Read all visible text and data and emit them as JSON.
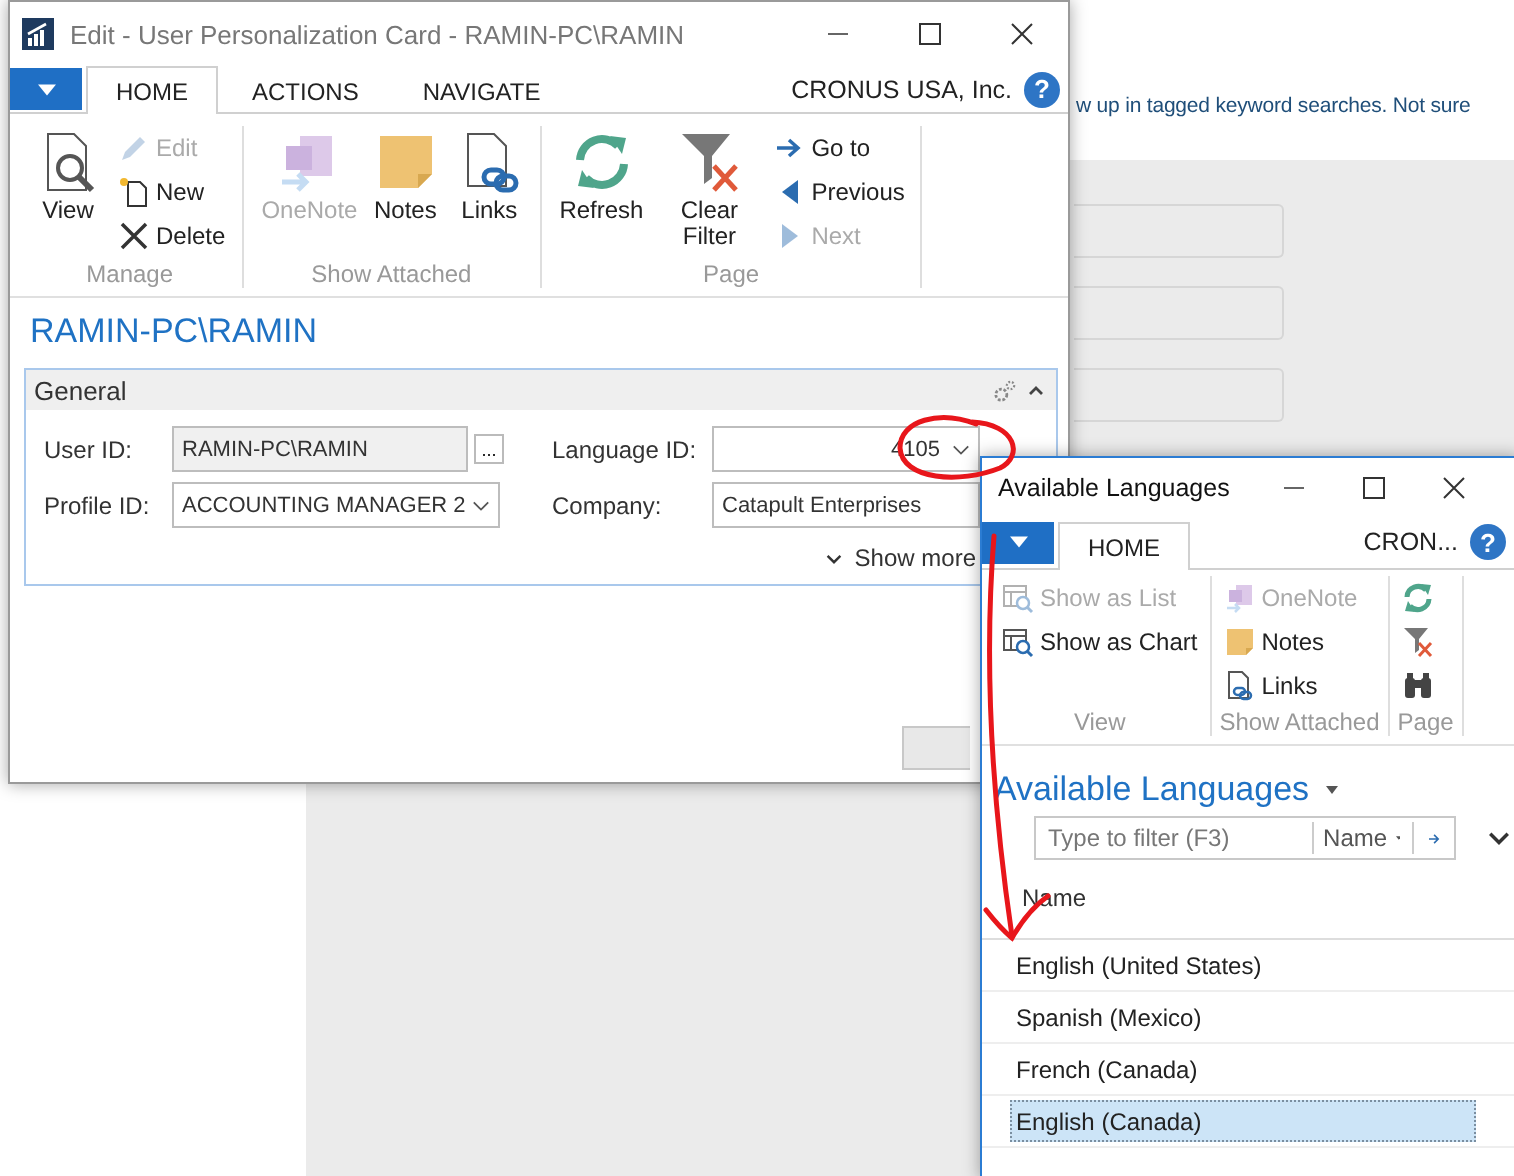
{
  "page": {
    "text": "w up in tagged keyword searches. Not sure"
  },
  "windows": [
    {
      "kind": "card",
      "title": "Edit - User Personalization Card - RAMIN-PC\\RAMIN",
      "tabs": [
        {
          "label": "HOME",
          "selected": true
        },
        {
          "label": "ACTIONS",
          "selected": false
        },
        {
          "label": "NAVIGATE",
          "selected": false
        }
      ],
      "company": "CRONUS USA, Inc.",
      "help": "?",
      "ribbon": [
        {
          "label": "Manage",
          "large": [
            {
              "label": "View",
              "kind": "view",
              "disabled": false
            }
          ],
          "small": [
            {
              "label": "Edit",
              "kind": "edit",
              "disabled": true
            },
            {
              "label": "New",
              "kind": "new",
              "disabled": false
            },
            {
              "label": "Delete",
              "kind": "delete",
              "disabled": false
            }
          ]
        },
        {
          "label": "Show Attached",
          "large": [
            {
              "label": "OneNote",
              "kind": "onenote",
              "disabled": true
            },
            {
              "label": "Notes",
              "kind": "notes",
              "disabled": false
            },
            {
              "label": "Links",
              "kind": "links",
              "disabled": false
            }
          ]
        },
        {
          "label": "Page",
          "large": [
            {
              "label": "Refresh",
              "kind": "refresh",
              "disabled": false
            },
            {
              "label": "Clear Filter",
              "kind": "clearfilter",
              "disabled": false
            }
          ],
          "small": [
            {
              "label": "Go to",
              "kind": "goto",
              "disabled": false
            },
            {
              "label": "Previous",
              "kind": "previous",
              "disabled": false
            },
            {
              "label": "Next",
              "kind": "next",
              "disabled": true
            }
          ]
        }
      ],
      "heading": "RAMIN-PC\\RAMIN",
      "section": {
        "title": "General",
        "expanded": true,
        "show_more": "Show more",
        "fields": [
          {
            "label": "User ID:",
            "value": "RAMIN-PC\\RAMIN",
            "kind": "assist",
            "assist": "...",
            "editable": false
          },
          {
            "label": "Language ID:",
            "value": "4105",
            "kind": "number",
            "editable": true
          },
          {
            "label": "Profile ID:",
            "value": "ACCOUNTING MANAGER 2",
            "kind": "dropdown",
            "editable": true
          },
          {
            "label": "Company:",
            "value": "Catapult Enterprises",
            "kind": "text",
            "editable": true
          }
        ]
      }
    },
    {
      "kind": "list",
      "title": "Available Languages",
      "tabs": [
        {
          "label": "HOME",
          "selected": true
        }
      ],
      "company": "CRON...",
      "help": "?",
      "ribbon": [
        {
          "label": "View",
          "small": [
            {
              "label": "Show as List",
              "kind": "list",
              "disabled": true
            },
            {
              "label": "Show as Chart",
              "kind": "chart",
              "disabled": false
            }
          ]
        },
        {
          "label": "Show Attached",
          "small": [
            {
              "label": "OneNote",
              "kind": "onenote",
              "disabled": true
            },
            {
              "label": "Notes",
              "kind": "notes",
              "disabled": false
            },
            {
              "label": "Links",
              "kind": "links",
              "disabled": false
            }
          ]
        },
        {
          "label": "Page",
          "small": [
            {
              "kind": "refresh",
              "disabled": false
            },
            {
              "kind": "clearfilter",
              "disabled": false
            },
            {
              "kind": "find",
              "disabled": false
            }
          ]
        }
      ],
      "heading": "Available Languages",
      "filter": {
        "placeholder": "Type to filter (F3)",
        "field": "Name"
      },
      "column": "Name",
      "rows": [
        {
          "name": "English (United States)",
          "selected": false
        },
        {
          "name": "Spanish (Mexico)",
          "selected": false
        },
        {
          "name": "French (Canada)",
          "selected": false
        },
        {
          "name": "English (Canada)",
          "selected": true
        }
      ]
    }
  ]
}
